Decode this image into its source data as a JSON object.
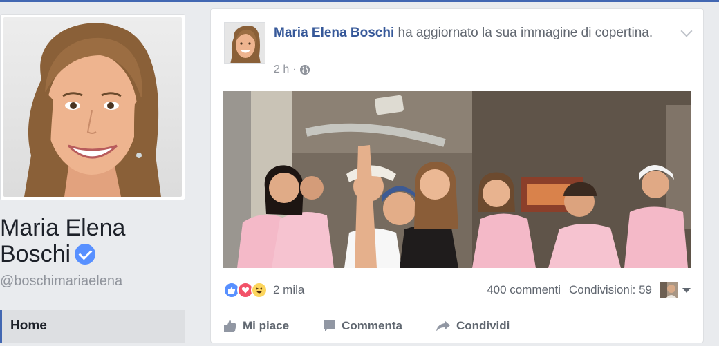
{
  "profile": {
    "name": "Maria Elena Boschi",
    "username": "@boschimariaelena",
    "verified": true,
    "nav": {
      "home_label": "Home"
    }
  },
  "post": {
    "author": "Maria Elena Boschi",
    "action_text": " ha aggiornato la sua immagine di copertina.",
    "time": "2 h",
    "meta_separator": "·",
    "privacy_icon": "globe-icon",
    "reactions": {
      "icons": [
        "like-icon",
        "love-icon",
        "haha-icon"
      ],
      "count": "2 mila"
    },
    "comments": "400 commenti",
    "shares": "Condivisioni: 59",
    "actions": {
      "like": "Mi piace",
      "comment": "Commenta",
      "share": "Condividi"
    }
  },
  "colors": {
    "link": "#365899",
    "accent": "#4267b2",
    "muted": "#90949c",
    "background": "#e9ebee"
  }
}
